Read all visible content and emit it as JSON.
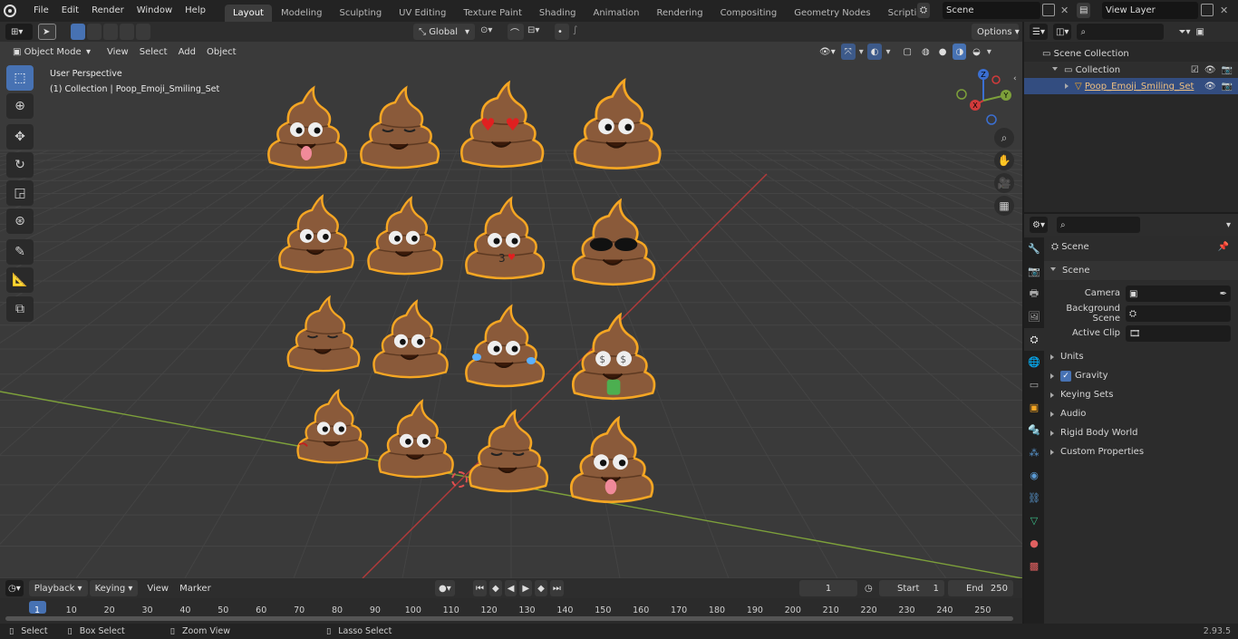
{
  "app": {
    "menus": [
      "File",
      "Edit",
      "Render",
      "Window",
      "Help"
    ],
    "workspaces": [
      "Layout",
      "Modeling",
      "Sculpting",
      "UV Editing",
      "Texture Paint",
      "Shading",
      "Animation",
      "Rendering",
      "Compositing",
      "Geometry Nodes",
      "Scripting"
    ],
    "active_workspace": "Layout",
    "add_tab": "+",
    "scene": "Scene",
    "view_layer": "View Layer",
    "version": "2.93.5"
  },
  "viewport_header": {
    "mode": "Object Mode",
    "menus": [
      "View",
      "Select",
      "Add",
      "Object"
    ],
    "transform_orientation": "Global",
    "options_label": "Options"
  },
  "viewport": {
    "perspective_label": "User Perspective",
    "collection_label": "(1) Collection | Poop_Emoji_Smiling_Set",
    "axes": {
      "x": "X",
      "y": "Y",
      "z": "Z"
    },
    "emoji_faces": [
      "tongue-out",
      "wink-smile",
      "heart-eyes",
      "worried",
      "surprised",
      "neutral",
      "kissing-heart",
      "sunglasses",
      "pensive",
      "angry-frown",
      "tears-of-joy",
      "money-mouth",
      "angry-red",
      "grinning",
      "kissing",
      "angry-tongue"
    ]
  },
  "outliner": {
    "scene_collection": "Scene Collection",
    "collection": "Collection",
    "object": "Poop_Emoji_Smiling_Set"
  },
  "properties": {
    "header": "Scene",
    "panel": "Scene",
    "camera_label": "Camera",
    "background_scene_label": "Background Scene",
    "active_clip_label": "Active Clip",
    "sections": [
      "Units",
      "Gravity",
      "Keying Sets",
      "Audio",
      "Rigid Body World",
      "Custom Properties"
    ],
    "gravity_enabled": true
  },
  "timeline": {
    "menus": [
      "Playback",
      "Keying",
      "View",
      "Marker"
    ],
    "current_frame": "1",
    "start_label": "Start",
    "start_value": "1",
    "end_label": "End",
    "end_value": "250",
    "ruler": [
      "1",
      "10",
      "20",
      "30",
      "40",
      "50",
      "60",
      "70",
      "80",
      "90",
      "100",
      "110",
      "120",
      "130",
      "140",
      "150",
      "160",
      "170",
      "180",
      "190",
      "200",
      "210",
      "220",
      "230",
      "240",
      "250"
    ]
  },
  "statusbar": {
    "select": "Select",
    "box_select": "Box Select",
    "zoom_view": "Zoom View",
    "lasso_select": "Lasso Select"
  },
  "colors": {
    "accent": "#4772b3",
    "selection_outline": "#f5a623",
    "emoji_brown": "#8a5a3a",
    "grid_x": "#b33a3a",
    "grid_y": "#7da03a"
  }
}
